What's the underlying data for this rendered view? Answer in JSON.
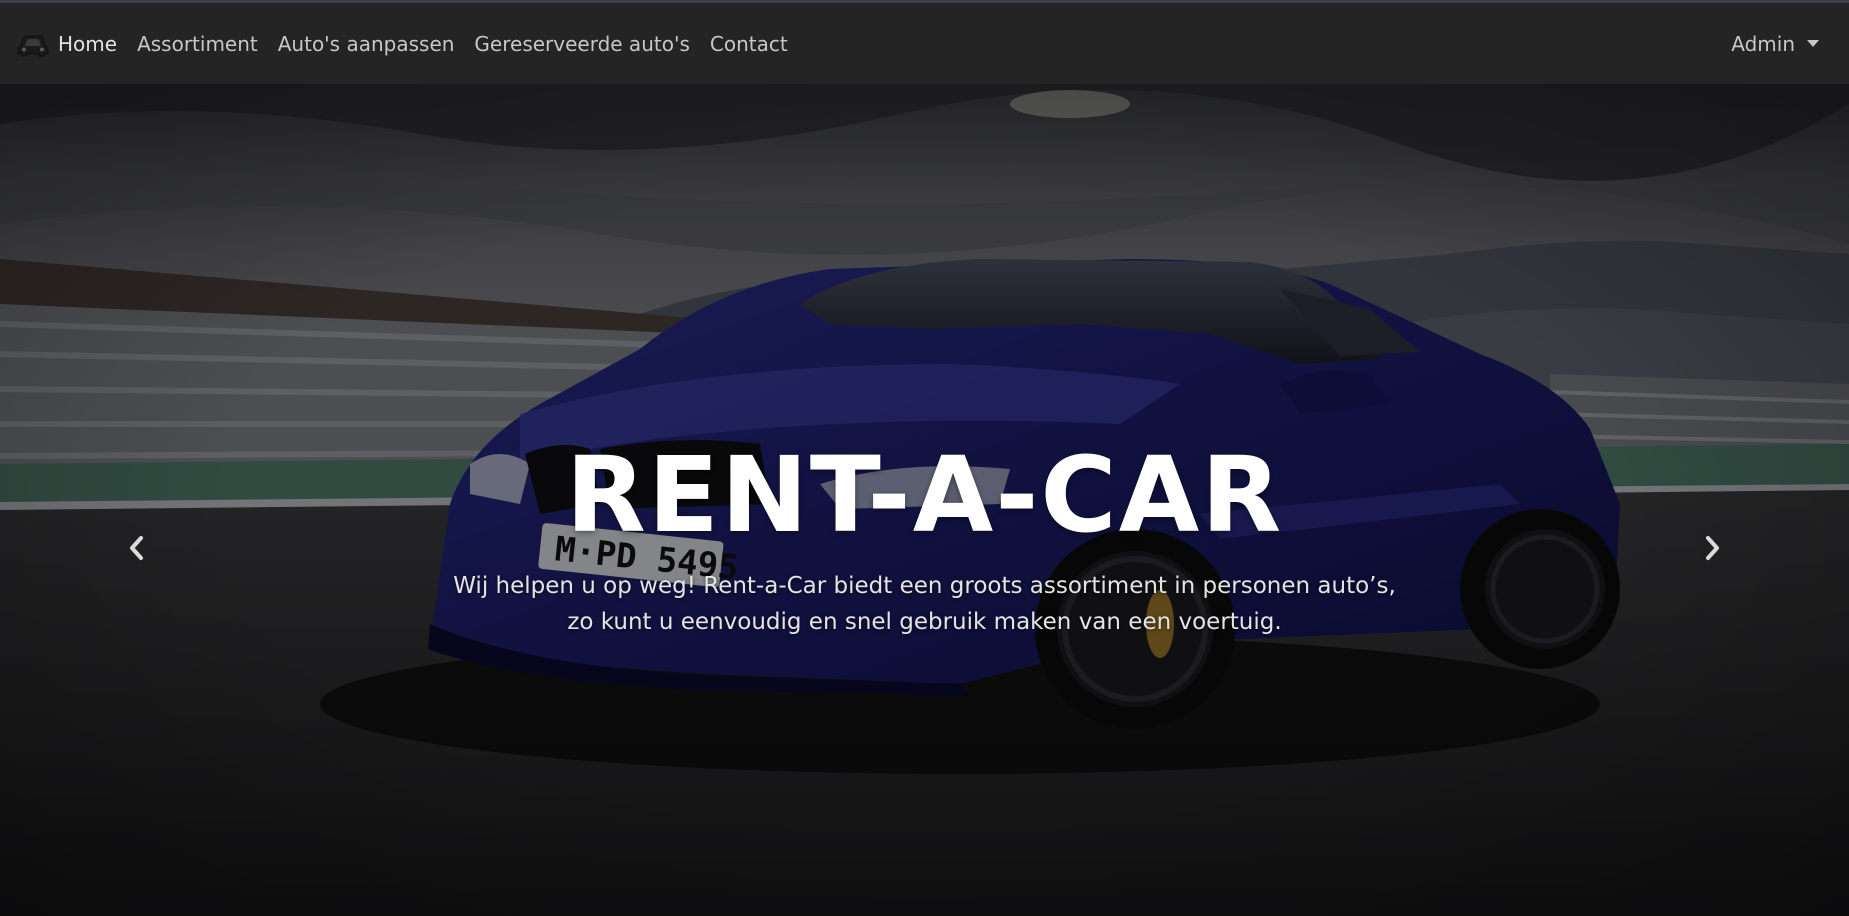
{
  "nav": {
    "brand_icon": "car-icon",
    "links": [
      {
        "label": "Home"
      },
      {
        "label": "Assortiment"
      },
      {
        "label": "Auto's aanpassen"
      },
      {
        "label": "Gereserveerde auto's"
      },
      {
        "label": "Contact"
      }
    ],
    "admin_label": "Admin"
  },
  "hero": {
    "title": "RENT-A-CAR",
    "text_line1": "Wij helpen u op weg! Rent-a-Car biedt een groots assortiment in personen auto’s,",
    "text_line2": "zo kunt u eenvoudig en snel gebruik maken van een voertuig.",
    "prev_icon": "chevron-left-icon",
    "next_icon": "chevron-right-icon"
  },
  "colors": {
    "navbar_bg": "#242424",
    "nav_text": "#c7c7c7",
    "car_blue": "#1e1e6e",
    "title": "#ffffff"
  }
}
